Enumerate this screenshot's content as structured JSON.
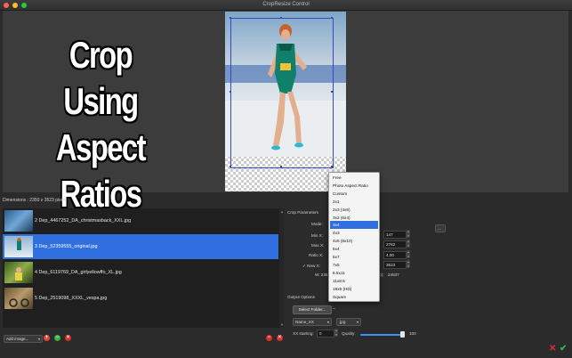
{
  "window": {
    "title": "CropResize Control"
  },
  "preview": {
    "overlay_line1": "Crop Using",
    "overlay_line2": "Aspect Ratios",
    "dimensions": "Dimensions : 2350 x 3523 pixels"
  },
  "images": [
    {
      "name": "2 Dep_4467252_DA_christmasback_XXL.jpg",
      "selected": false
    },
    {
      "name": "3 Dep_52359555_original.jpg",
      "selected": true
    },
    {
      "name": "4 Dep_6119769_DA_girlyellowffo_XL.jpg",
      "selected": false
    },
    {
      "name": "5 Dep_2519098_XXXL_vespa.jpg",
      "selected": false
    }
  ],
  "left_controls": {
    "add_image": "Add image...",
    "add_icon": "+",
    "remove_icon": "−",
    "clear_icon": "×"
  },
  "crop": {
    "section_label": "Crop Parameters",
    "mode_label": "Mode:",
    "minx_label": "Min X:",
    "maxx_label": "Max X:",
    "ratiox_label": "Ratio X:",
    "new_label": "New",
    "x_label": "X:",
    "w_label": "W: 235",
    "min_y_value": "147",
    "max_y_value": "2762",
    "ratio_y_value": "4.00",
    "new_y_value": "3523",
    "kb_label": "kb):",
    "kb_value": "24837",
    "top_dropdown_value": "..."
  },
  "mode_options": [
    "Free",
    "Photo Aspect Ratio",
    "Custom",
    "2x1",
    "2x3 (4x6)",
    "3x2 (6x4)",
    "3x4",
    "4x3",
    "4x5 (8x10)",
    "5x4",
    "5x7",
    "7x5",
    "8.5x11",
    "11x8.5",
    "16x9 (HD)",
    "Square"
  ],
  "mode_selected_index": 6,
  "output": {
    "section_label": "Output Options",
    "select_folder": "Select Folder...",
    "folder_path": "~",
    "name_pattern": "Name_XX",
    "format": ".jpg",
    "xx_label": "XX starting:",
    "xx_value": "0",
    "quality_label": "Quality:",
    "quality_value": "100",
    "quality_fraction": 0.95
  },
  "actions": {
    "cancel_icon": "✕",
    "ok_icon": "✔"
  },
  "colors": {
    "accent": "#2f6fe0",
    "crop_box": "#3a46c8",
    "cancel": "#d9302c",
    "ok": "#3cb043"
  }
}
